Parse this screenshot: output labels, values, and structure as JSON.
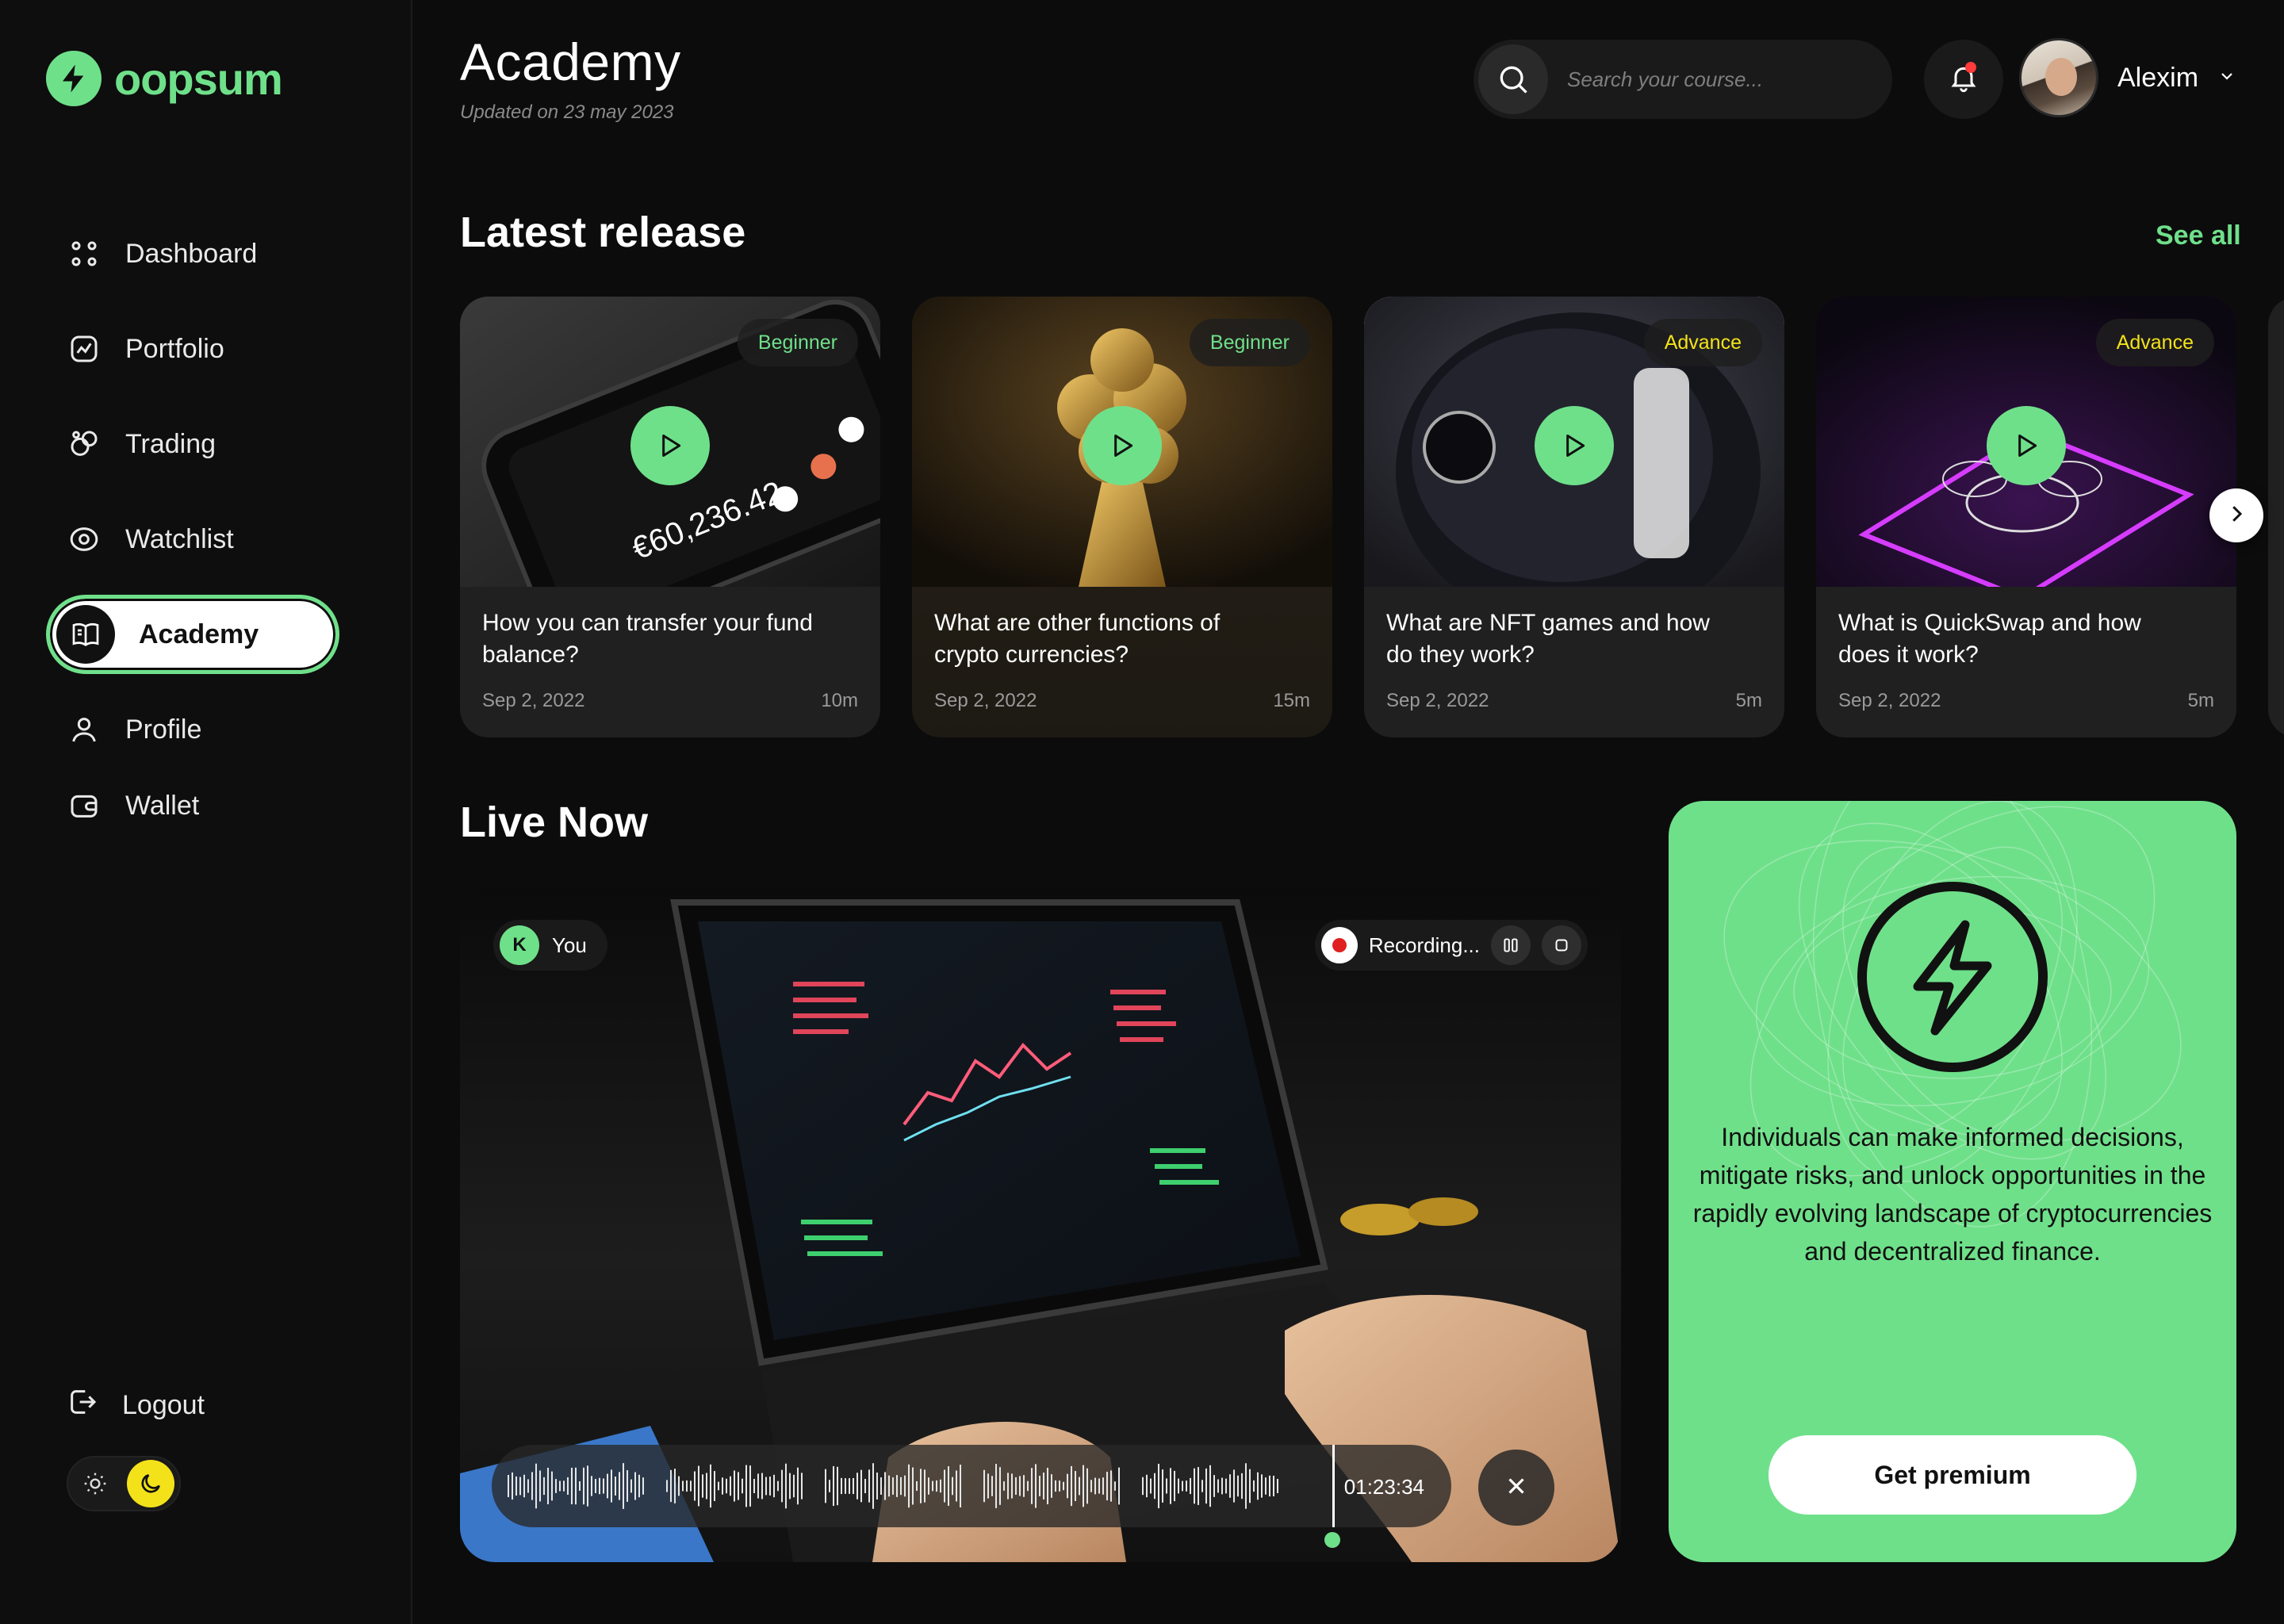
{
  "app": {
    "name": "oopsum"
  },
  "sidebar": {
    "items": [
      {
        "label": "Dashboard",
        "icon": "dashboard-icon"
      },
      {
        "label": "Portfolio",
        "icon": "portfolio-icon"
      },
      {
        "label": "Trading",
        "icon": "trading-icon"
      },
      {
        "label": "Watchlist",
        "icon": "eye-icon"
      },
      {
        "label": "Academy",
        "icon": "book-icon",
        "active": true
      },
      {
        "label": "Profile",
        "icon": "user-icon"
      },
      {
        "label": "Wallet",
        "icon": "wallet-icon"
      }
    ],
    "logout_label": "Logout",
    "theme": "dark"
  },
  "header": {
    "title": "Academy",
    "subtitle": "Updated on 23 may 2023",
    "search_placeholder": "Search your course...",
    "user_name": "Alexim",
    "has_notification": true
  },
  "latest": {
    "title": "Latest release",
    "see_all": "See all",
    "cards": [
      {
        "badge": "Beginner",
        "level": "beginner",
        "title": "How you can transfer your fund balance?",
        "date": "Sep 2, 2022",
        "duration": "10m",
        "overlay": "€60,236.42"
      },
      {
        "badge": "Beginner",
        "level": "beginner",
        "title": "What are other functions of crypto currencies?",
        "date": "Sep 2, 2022",
        "duration": "15m"
      },
      {
        "badge": "Advance",
        "level": "advance",
        "title": "What are NFT games and how do they work?",
        "date": "Sep 2, 2022",
        "duration": "5m"
      },
      {
        "badge": "Advance",
        "level": "advance",
        "title": "What is QuickSwap and how does it work?",
        "date": "Sep 2, 2022",
        "duration": "5m"
      }
    ]
  },
  "live": {
    "title": "Live Now",
    "participant_initial": "K",
    "participant_label": "You",
    "recording_label": "Recording...",
    "time": "01:23:34"
  },
  "premium": {
    "description": "Individuals can make informed decisions, mitigate risks, and unlock opportunities in the rapidly evolving landscape of cryptocurrencies and decentralized finance.",
    "cta": "Get premium"
  },
  "colors": {
    "accent": "#6fe08a",
    "advance": "#f3e21a",
    "background": "#0c0c0c",
    "recording": "#e02020"
  }
}
